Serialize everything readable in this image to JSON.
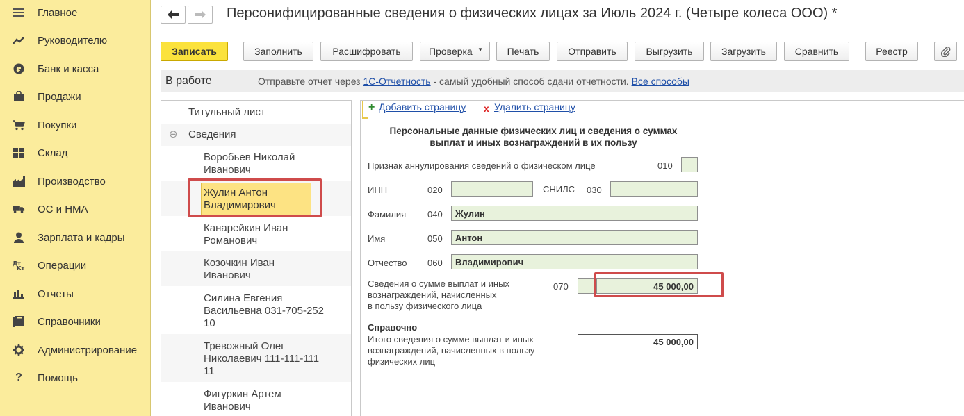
{
  "sidebar": {
    "items": [
      {
        "label": "Главное",
        "icon": "menu-icon"
      },
      {
        "label": "Руководителю",
        "icon": "trend-icon"
      },
      {
        "label": "Банк и касса",
        "icon": "coin-icon"
      },
      {
        "label": "Продажи",
        "icon": "bag-icon"
      },
      {
        "label": "Покупки",
        "icon": "cart-icon"
      },
      {
        "label": "Склад",
        "icon": "warehouse-icon"
      },
      {
        "label": "Производство",
        "icon": "factory-icon"
      },
      {
        "label": "ОС и НМА",
        "icon": "truck-icon"
      },
      {
        "label": "Зарплата и кадры",
        "icon": "person-icon"
      },
      {
        "label": "Операции",
        "icon": "operations-icon"
      },
      {
        "label": "Отчеты",
        "icon": "bar-chart-icon"
      },
      {
        "label": "Справочники",
        "icon": "book-icon"
      },
      {
        "label": "Администрирование",
        "icon": "gear-icon"
      },
      {
        "label": "Помощь",
        "icon": "question-icon"
      }
    ]
  },
  "header": {
    "back": "🡐",
    "forward": "🡒",
    "title": "Персонифицированные сведения о физических лицах за Июль 2024 г. (Четыре колеса ООО) *"
  },
  "toolbar": {
    "save": "Записать",
    "fill": "Заполнить",
    "decode": "Расшифровать",
    "check": "Проверка",
    "print": "Печать",
    "send": "Отправить",
    "export": "Выгрузить",
    "import": "Загрузить",
    "compare": "Сравнить",
    "registry": "Реестр"
  },
  "infobar": {
    "status": "В работе",
    "text_before": "Отправьте отчет через ",
    "link1": "1С-Отчетность",
    "text_middle": " - самый удобный способ сдачи отчетности. ",
    "link2": "Все способы"
  },
  "tree": {
    "title_page": "Титульный лист",
    "section": "Сведения",
    "collapse_symbol": "⊖",
    "people": [
      {
        "line1": "Воробьев Николай",
        "line2": "Иванович"
      },
      {
        "line1": "Жулин Антон",
        "line2": "Владимирович"
      },
      {
        "line1": "Канарейкин Иван",
        "line2": "Романович"
      },
      {
        "line1": "Козочкин Иван",
        "line2": "Иванович"
      },
      {
        "line1": "Силина Евгения",
        "line2": "Васильевна 031-705-252",
        "line3": "10"
      },
      {
        "line1": "Тревожный Олег",
        "line2": "Николаевич 111-111-111",
        "line3": "11"
      },
      {
        "line1": "Фигуркин Артем",
        "line2": "Иванович"
      }
    ]
  },
  "form": {
    "add_page": "Добавить страницу",
    "delete_page": "Удалить страницу",
    "add_symbol": "+",
    "delete_symbol": "x",
    "heading_line1": "Персональные данные физических лиц и сведения о суммах",
    "heading_line2": "выплат и иных вознаграждений в их пользу",
    "cancel_label": "Признак аннулирования сведений о физическом лице",
    "code_010": "010",
    "inn_label": "ИНН",
    "code_020": "020",
    "snils_label": "СНИЛС",
    "code_030": "030",
    "surname_label": "Фамилия",
    "code_040": "040",
    "surname": "Жулин",
    "name_label": "Имя",
    "code_050": "050",
    "name": "Антон",
    "patronymic_label": "Отчество",
    "code_060": "060",
    "patronymic": "Владимирович",
    "payments_label_1": "Сведения о сумме выплат и иных",
    "payments_label_2": "вознаграждений, начисленных",
    "payments_label_3": "в пользу физического лица",
    "code_070": "070",
    "payments_amount": "45 000,00",
    "reference_heading": "Справочно",
    "total_label_1": "Итого сведения о сумме выплат и иных",
    "total_label_2": "вознаграждений, начисленных в пользу",
    "total_label_3": "физических лиц",
    "total_amount": "45 000,00"
  }
}
